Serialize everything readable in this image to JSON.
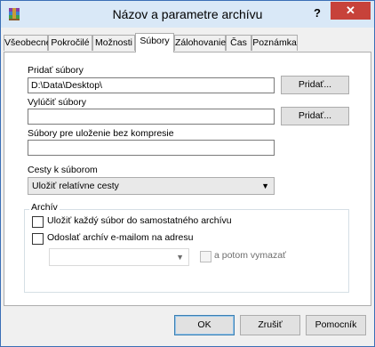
{
  "window": {
    "title": "Názov a parametre archívu",
    "help": "?",
    "close": "✕"
  },
  "tabs": [
    "Všeobecné",
    "Pokročilé",
    "Možnosti",
    "Súbory",
    "Zálohovanie",
    "Čas",
    "Poznámka"
  ],
  "active_tab": "Súbory",
  "files": {
    "add_label": "Pridať súbory",
    "add_value": "D:\\Data\\Desktop\\",
    "add_button": "Pridať...",
    "exclude_label": "Vylúčiť súbory",
    "exclude_value": "",
    "exclude_button": "Pridať...",
    "nocompress_label": "Súbory pre uloženie bez kompresie",
    "nocompress_value": ""
  },
  "paths": {
    "label": "Cesty k súborom",
    "selected": "Uložiť relatívne cesty"
  },
  "archive": {
    "group_label": "Archív",
    "separate_label": "Uložiť každý súbor do samostatného archívu",
    "separate_checked": false,
    "email_label": "Odoslať archív e-mailom na adresu",
    "email_checked": false,
    "email_value": "",
    "delete_label": "a potom vymazať",
    "delete_checked": false
  },
  "footer": {
    "ok": "OK",
    "cancel": "Zrušiť",
    "help": "Pomocník"
  }
}
